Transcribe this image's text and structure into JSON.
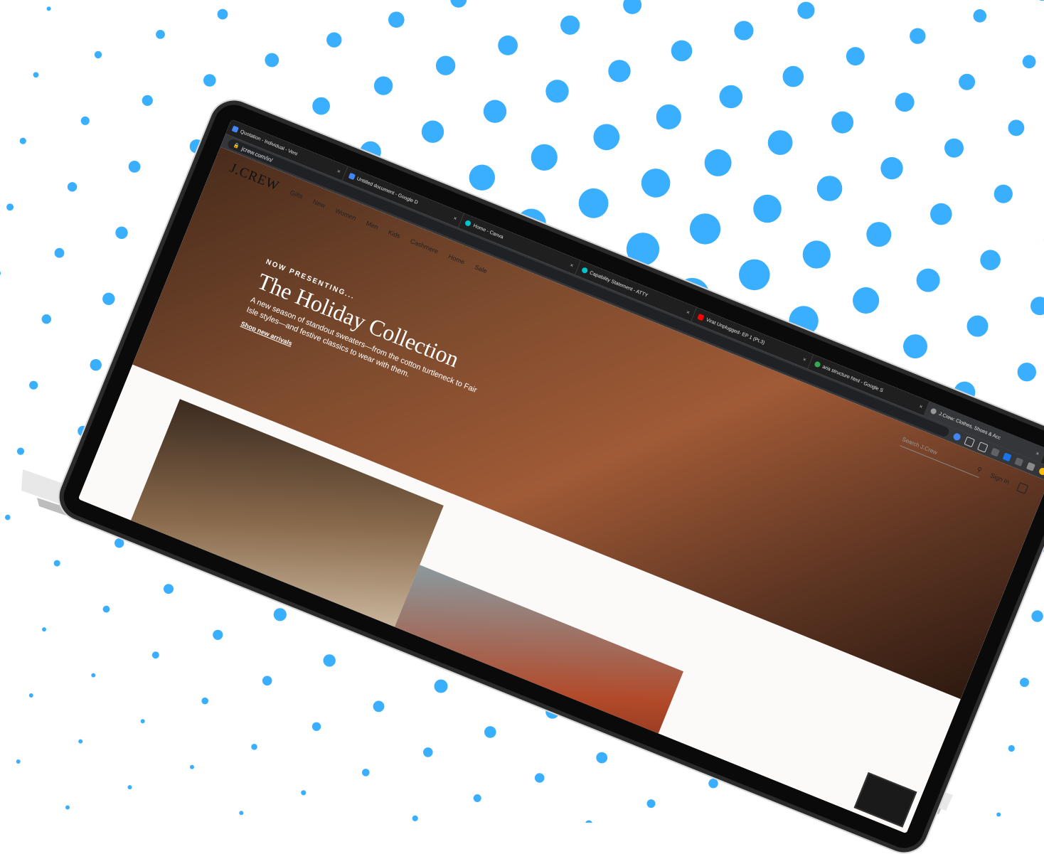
{
  "colors": {
    "dot": "#3AAFFF",
    "bezel": "#0a0a0a",
    "base": "#E6E6E6",
    "chrome_dark": "#1f1f1f"
  },
  "browser": {
    "tabs": [
      {
        "label": "Quotation - Individual - Veni",
        "icon": "docs-icon",
        "active": false
      },
      {
        "label": "Untitled document - Google D",
        "icon": "docs-icon",
        "active": false
      },
      {
        "label": "Home - Canva",
        "icon": "canva-icon",
        "active": false
      },
      {
        "label": "Capability Statement - ATTY",
        "icon": "canva-icon",
        "active": false
      },
      {
        "label": "Virat Unplugged- EP 1 (Pt.3)",
        "icon": "youtube-icon",
        "active": false
      },
      {
        "label": "aria structure html - Google S",
        "icon": "google-icon",
        "active": false
      },
      {
        "label": "J.Crew: Clothes, Shoes & Acc",
        "icon": "globe-icon",
        "active": true
      }
    ],
    "new_tab_label": "+",
    "url": "jcrew.com/in/"
  },
  "site": {
    "logo": "J.CREW",
    "nav": [
      "Gifts",
      "New",
      "Women",
      "Men",
      "Kids",
      "Cashmere",
      "Home",
      "Sale"
    ],
    "search_placeholder": "Search J.Crew",
    "sign_in": "Sign In",
    "hero": {
      "eyebrow": "NOW PRESENTING...",
      "title": "The Holiday Collection",
      "body": "A new season of standout sweaters—from the cotton turtleneck to Fair Isle styles—and festive classics to wear with them.",
      "cta": "Shop new arrivals"
    }
  }
}
